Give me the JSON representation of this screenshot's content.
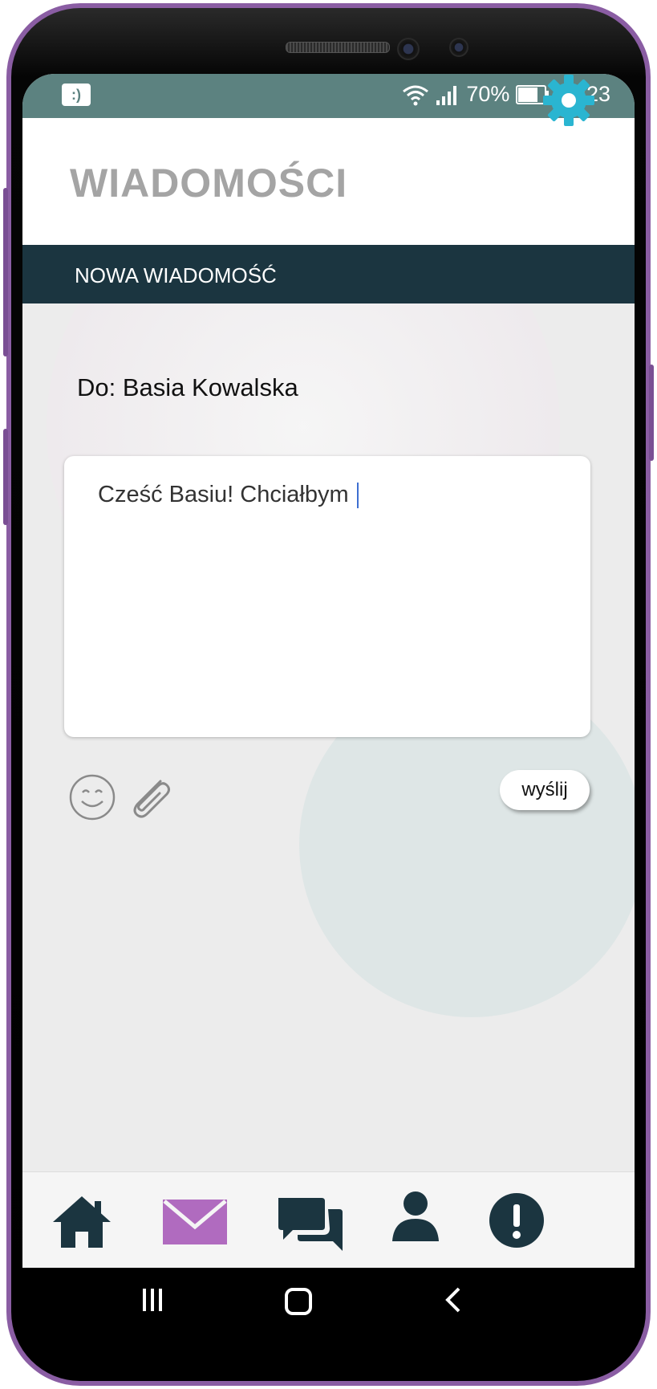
{
  "status_bar": {
    "battery": "70%",
    "time": "12:23",
    "notification_glyph": ":)"
  },
  "header": {
    "title": "WIADOMOŚCI"
  },
  "section": {
    "title": "NOWA WIADOMOŚĆ"
  },
  "compose": {
    "recipient_line": "Do: Basia Kowalska",
    "message_text": "Cześć Basiu! Chciałbym",
    "send_label": "wyślij"
  },
  "bottom_nav": {
    "items": [
      {
        "icon": "home-icon",
        "active": false
      },
      {
        "icon": "mail-icon",
        "active": true
      },
      {
        "icon": "chat-icon",
        "active": false
      },
      {
        "icon": "profile-icon",
        "active": false
      },
      {
        "icon": "alert-icon",
        "active": false
      }
    ],
    "active_color": "#b06bbf",
    "icon_color": "#1b3540"
  },
  "system_nav": {
    "icons": [
      "recent-apps-icon",
      "home-button-icon",
      "back-icon"
    ]
  },
  "colors": {
    "status_bar": "#5c8280",
    "section_bar": "#1b3540",
    "accent_gear": "#2ab5d1",
    "title": "#a4a4a4"
  }
}
